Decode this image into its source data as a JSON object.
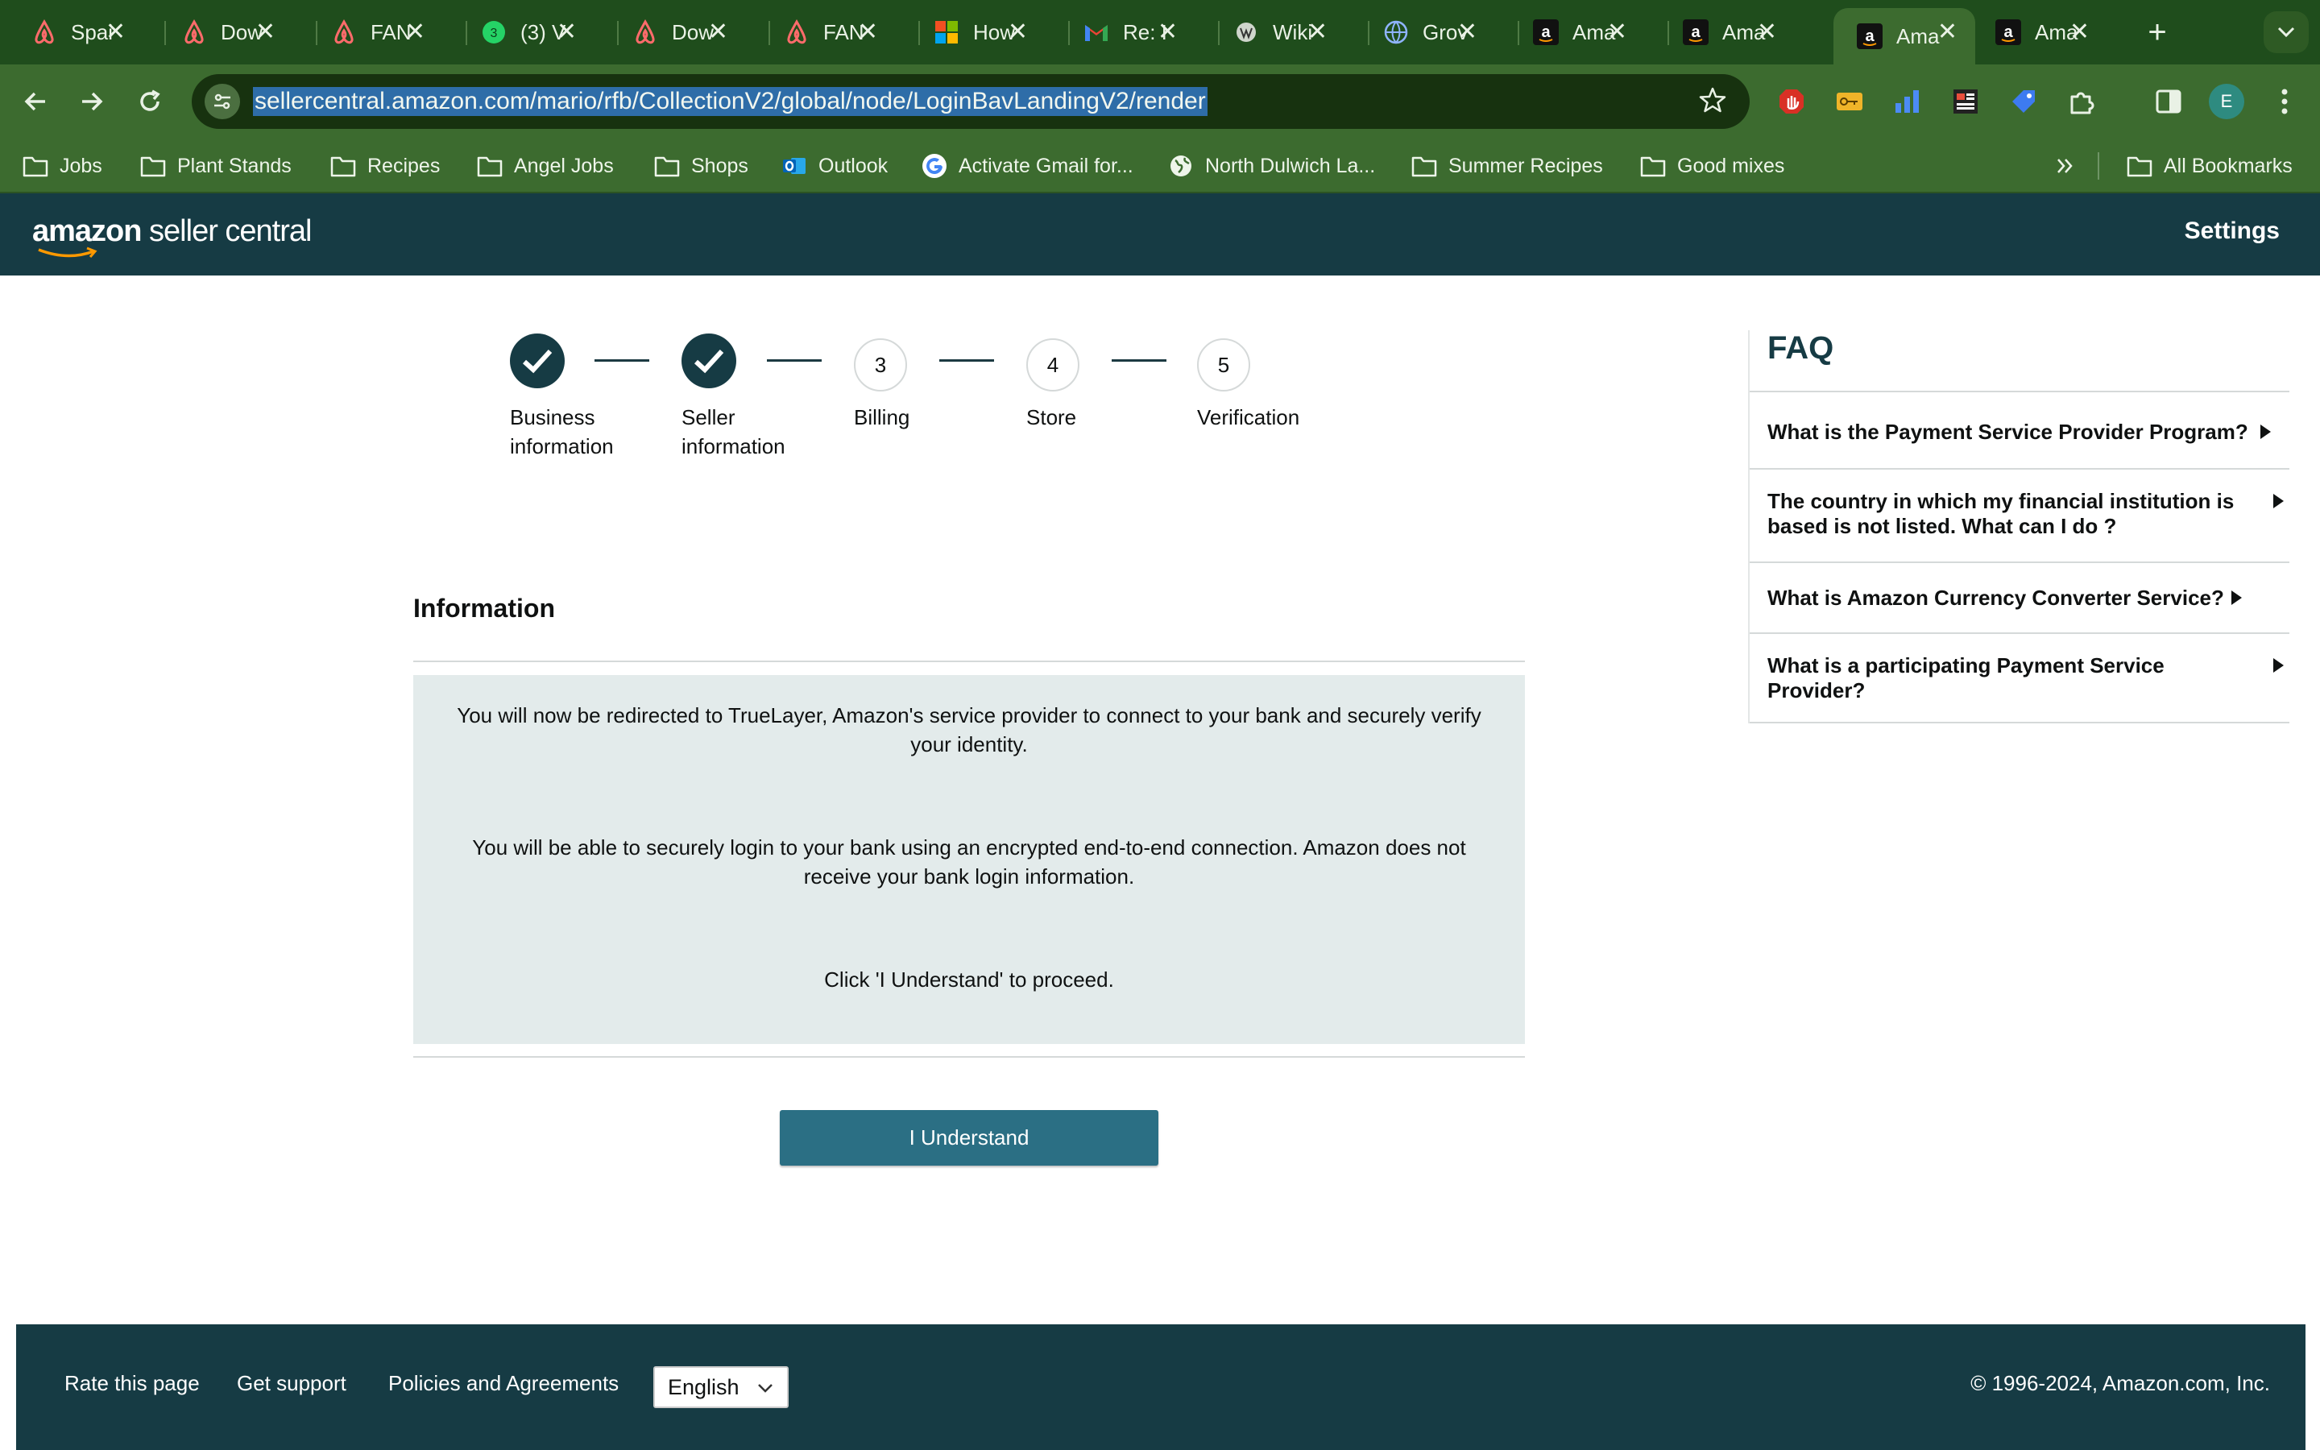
{
  "browser": {
    "tabs": [
      {
        "title": "Spai",
        "icon": "airbnb-icon"
      },
      {
        "title": "Dow",
        "icon": "airbnb-icon"
      },
      {
        "title": "FAN",
        "icon": "airbnb-icon"
      },
      {
        "title": "(3) V",
        "icon": "whatsapp-icon",
        "badge": "3"
      },
      {
        "title": "Dow",
        "icon": "airbnb-icon"
      },
      {
        "title": "FAN",
        "icon": "airbnb-icon"
      },
      {
        "title": "How",
        "icon": "microsoft-icon"
      },
      {
        "title": "Re: I",
        "icon": "gmail-icon"
      },
      {
        "title": "Wiki",
        "icon": "wikipedia-icon"
      },
      {
        "title": "Grov",
        "icon": "globe-icon"
      },
      {
        "title": "Ama",
        "icon": "amazon-icon"
      },
      {
        "title": "Ama",
        "icon": "amazon-icon"
      },
      {
        "title": "Ama",
        "icon": "amazon-icon",
        "active": true
      },
      {
        "title": "Ama",
        "icon": "amazon-icon"
      }
    ],
    "url": "sellercentral.amazon.com/mario/rfb/CollectionV2/global/node/LoginBavLandingV2/render",
    "profile_initial": "E",
    "bookmarks": [
      {
        "label": "Jobs",
        "icon": "folder-icon"
      },
      {
        "label": "Plant Stands",
        "icon": "folder-icon"
      },
      {
        "label": "Recipes",
        "icon": "folder-icon"
      },
      {
        "label": "Angel Jobs",
        "icon": "folder-icon"
      },
      {
        "label": "Shops",
        "icon": "folder-icon"
      },
      {
        "label": "Outlook",
        "icon": "outlook-icon"
      },
      {
        "label": "Activate Gmail for...",
        "icon": "google-icon"
      },
      {
        "label": "North Dulwich La...",
        "icon": "globe-icon"
      },
      {
        "label": "Summer Recipes",
        "icon": "folder-icon"
      },
      {
        "label": "Good mixes",
        "icon": "folder-icon"
      }
    ],
    "all_bookmarks": "All Bookmarks"
  },
  "header": {
    "logo_brand": "amazon",
    "logo_product": "seller central",
    "settings": "Settings"
  },
  "stepper": {
    "steps": [
      {
        "number": "1",
        "line1": "Business",
        "line2": "information",
        "status": "complete"
      },
      {
        "number": "2",
        "line1": "Seller",
        "line2": "information",
        "status": "complete"
      },
      {
        "number": "3",
        "line1": "Billing",
        "line2": "",
        "status": "pending"
      },
      {
        "number": "4",
        "line1": "Store",
        "line2": "",
        "status": "pending"
      },
      {
        "number": "5",
        "line1": "Verification",
        "line2": "",
        "status": "pending"
      }
    ]
  },
  "info": {
    "title": "Information",
    "p1": "You will now be redirected to TrueLayer, Amazon's service provider to connect to your bank and securely verify your identity.",
    "p2": "You will be able to securely login to your bank using an encrypted end-to-end connection. Amazon does not receive your bank login information.",
    "p3": "Click 'I Understand' to proceed.",
    "button": "I Understand"
  },
  "faq": {
    "title": "FAQ",
    "items": [
      "What is the Payment Service Provider Program?",
      "The country in which my financial institution is based is not listed. What can I do ?",
      "What is Amazon Currency Converter Service?",
      "What is a participating Payment Service Provider?"
    ]
  },
  "footer": {
    "rate": "Rate this page",
    "support": "Get support",
    "policies": "Policies and Agreements",
    "language": "English",
    "copyright": "© 1996-2024, Amazon.com, Inc."
  },
  "colors": {
    "chrome_dark": "#1f4d1c",
    "chrome_toolbar": "#3c6b2f",
    "sc_header": "#163b44",
    "button": "#2b6f84",
    "info_box": "#e3ebeb"
  }
}
